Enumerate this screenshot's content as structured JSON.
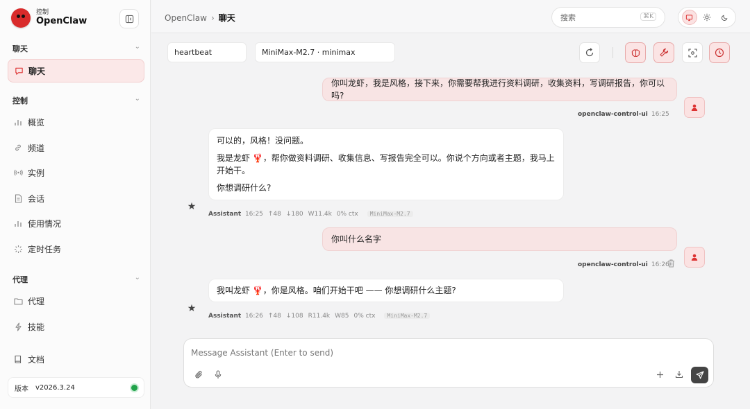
{
  "brand": {
    "sub": "控制",
    "name": "OpenClaw"
  },
  "sidebar": {
    "sections": [
      {
        "title": "聊天",
        "items": [
          {
            "label": "聊天",
            "icon": "message-icon",
            "active": true
          }
        ]
      },
      {
        "title": "控制",
        "items": [
          {
            "label": "概览",
            "icon": "bar-chart-icon"
          },
          {
            "label": "频道",
            "icon": "link-icon"
          },
          {
            "label": "实例",
            "icon": "broadcast-icon"
          },
          {
            "label": "会话",
            "icon": "document-icon"
          },
          {
            "label": "使用情况",
            "icon": "bar-chart-icon"
          },
          {
            "label": "定时任务",
            "icon": "loader-icon"
          }
        ]
      },
      {
        "title": "代理",
        "items": [
          {
            "label": "代理",
            "icon": "folder-icon"
          },
          {
            "label": "技能",
            "icon": "bolt-icon"
          }
        ]
      }
    ],
    "docs": "文档",
    "version_label": "版本",
    "version_value": "v2026.3.24",
    "status_color": "#21a34a"
  },
  "topbar": {
    "breadcrumb_root": "OpenClaw",
    "breadcrumb_sep": "›",
    "breadcrumb_current": "聊天",
    "search_placeholder": "搜索",
    "search_shortcut": "⌘K"
  },
  "session": {
    "session_key": "heartbeat",
    "model": "MiniMax-M2.7 · minimax"
  },
  "messages": [
    {
      "role": "user",
      "text": "你叫龙虾，我是风格，接下来，你需要帮我进行资料调研，收集资料，写调研报告，你可以吗?",
      "sender": "openclaw-control-ui",
      "time": "16:25"
    },
    {
      "role": "assistant",
      "paragraphs": [
        "可以的，风格！没问题。",
        "我是龙虾 🦞，帮你做资料调研、收集信息、写报告完全可以。你说个方向或者主题，我马上开始干。",
        "你想调研什么?"
      ],
      "sender": "Assistant",
      "time": "16:25",
      "stats": [
        "↑48",
        "↓180",
        "W11.4k",
        "0% ctx"
      ],
      "model_tag": "MiniMax-M2.7"
    },
    {
      "role": "user",
      "text": "你叫什么名字",
      "sender": "openclaw-control-ui",
      "time": "16:26"
    },
    {
      "role": "assistant",
      "paragraphs": [
        "我叫龙虾 🦞，你是风格。咱们开始干吧 —— 你想调研什么主题?"
      ],
      "sender": "Assistant",
      "time": "16:26",
      "stats": [
        "↑48",
        "↓108",
        "R11.4k",
        "W85",
        "0% ctx"
      ],
      "model_tag": "MiniMax-M2.7"
    }
  ],
  "composer": {
    "placeholder": "Message Assistant (Enter to send)"
  },
  "colors": {
    "accent": "#d33333",
    "user_bubble": "#f8e4e4",
    "send_button": "#444444"
  }
}
